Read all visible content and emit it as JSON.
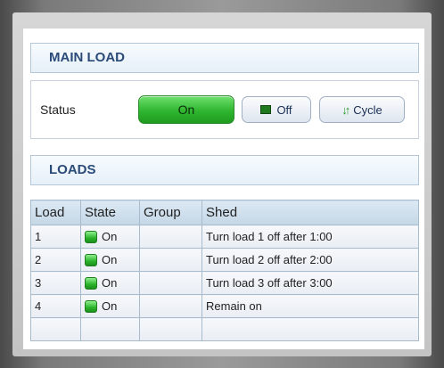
{
  "main_load": {
    "title": "MAIN LOAD",
    "status_label": "Status",
    "on_label": "On",
    "off_label": "Off",
    "cycle_label": "Cycle"
  },
  "loads": {
    "title": "LOADS",
    "columns": [
      "Load",
      "State",
      "Group",
      "Shed"
    ],
    "rows": [
      {
        "load": "1",
        "state": "On",
        "group": "",
        "shed": "Turn load 1 off after  1:00"
      },
      {
        "load": "2",
        "state": "On",
        "group": "",
        "shed": "Turn load 2 off after  2:00"
      },
      {
        "load": "3",
        "state": "On",
        "group": "",
        "shed": "Turn load 3 off after  3:00"
      },
      {
        "load": "4",
        "state": "On",
        "group": "",
        "shed": "Remain on"
      }
    ]
  },
  "colors": {
    "header_text": "#2a4a78",
    "on_green": "#2fb62f"
  },
  "icons": {
    "off": "square-stop-icon",
    "cycle": "up-down-arrows-icon",
    "state": "green-led-icon"
  }
}
